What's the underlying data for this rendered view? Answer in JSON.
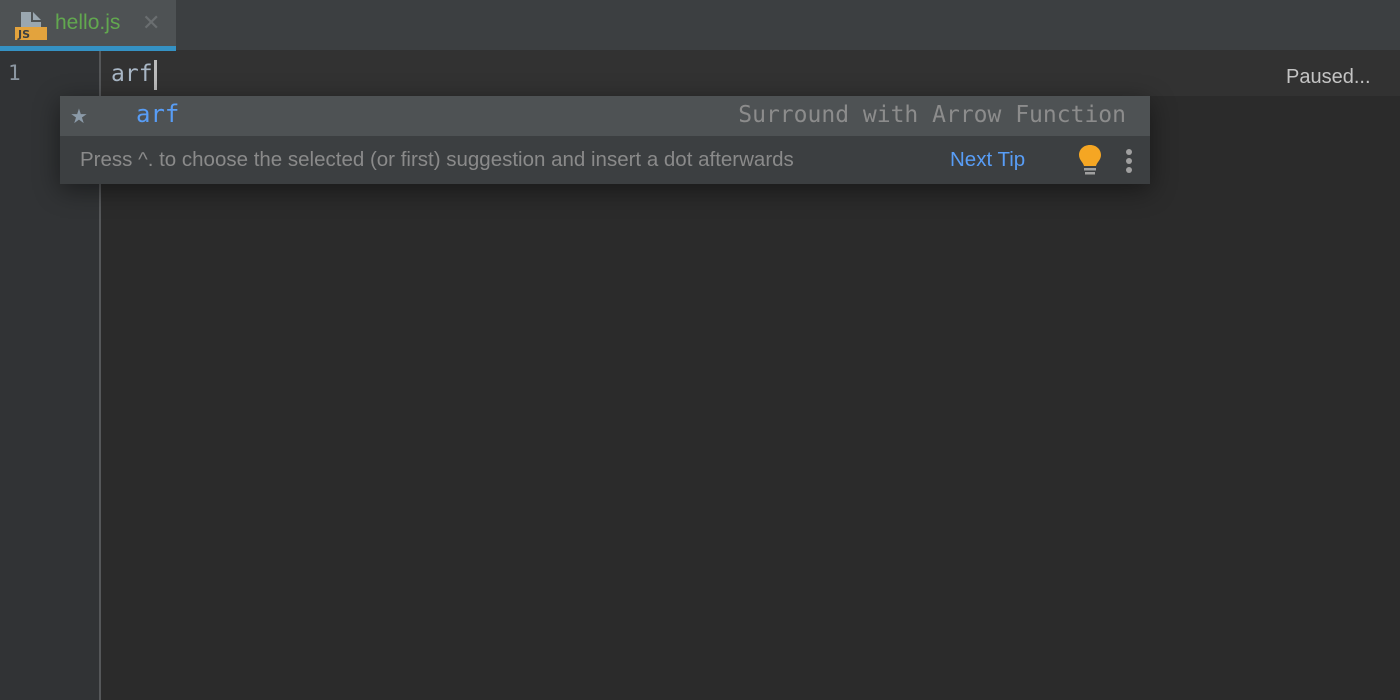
{
  "tabs": [
    {
      "label": "hello.js",
      "icon": "js-file-icon",
      "active": true,
      "close_glyph": "✕"
    }
  ],
  "gutter": {
    "line_numbers": [
      "1"
    ]
  },
  "editor": {
    "lines": [
      "arf"
    ]
  },
  "status_badge": "Paused...",
  "completion_popup": {
    "items": [
      {
        "star": "★",
        "name": "arf",
        "description": "Surround with Arrow Function",
        "selected": true
      }
    ],
    "tip_text": "Press ^. to choose the selected (or first) suggestion and insert a dot afterwards",
    "next_tip_label": "Next Tip"
  },
  "colors": {
    "accent": "#3592c4",
    "tab_label": "#62a84f",
    "link": "#589df6",
    "bulb": "#f5a623"
  }
}
